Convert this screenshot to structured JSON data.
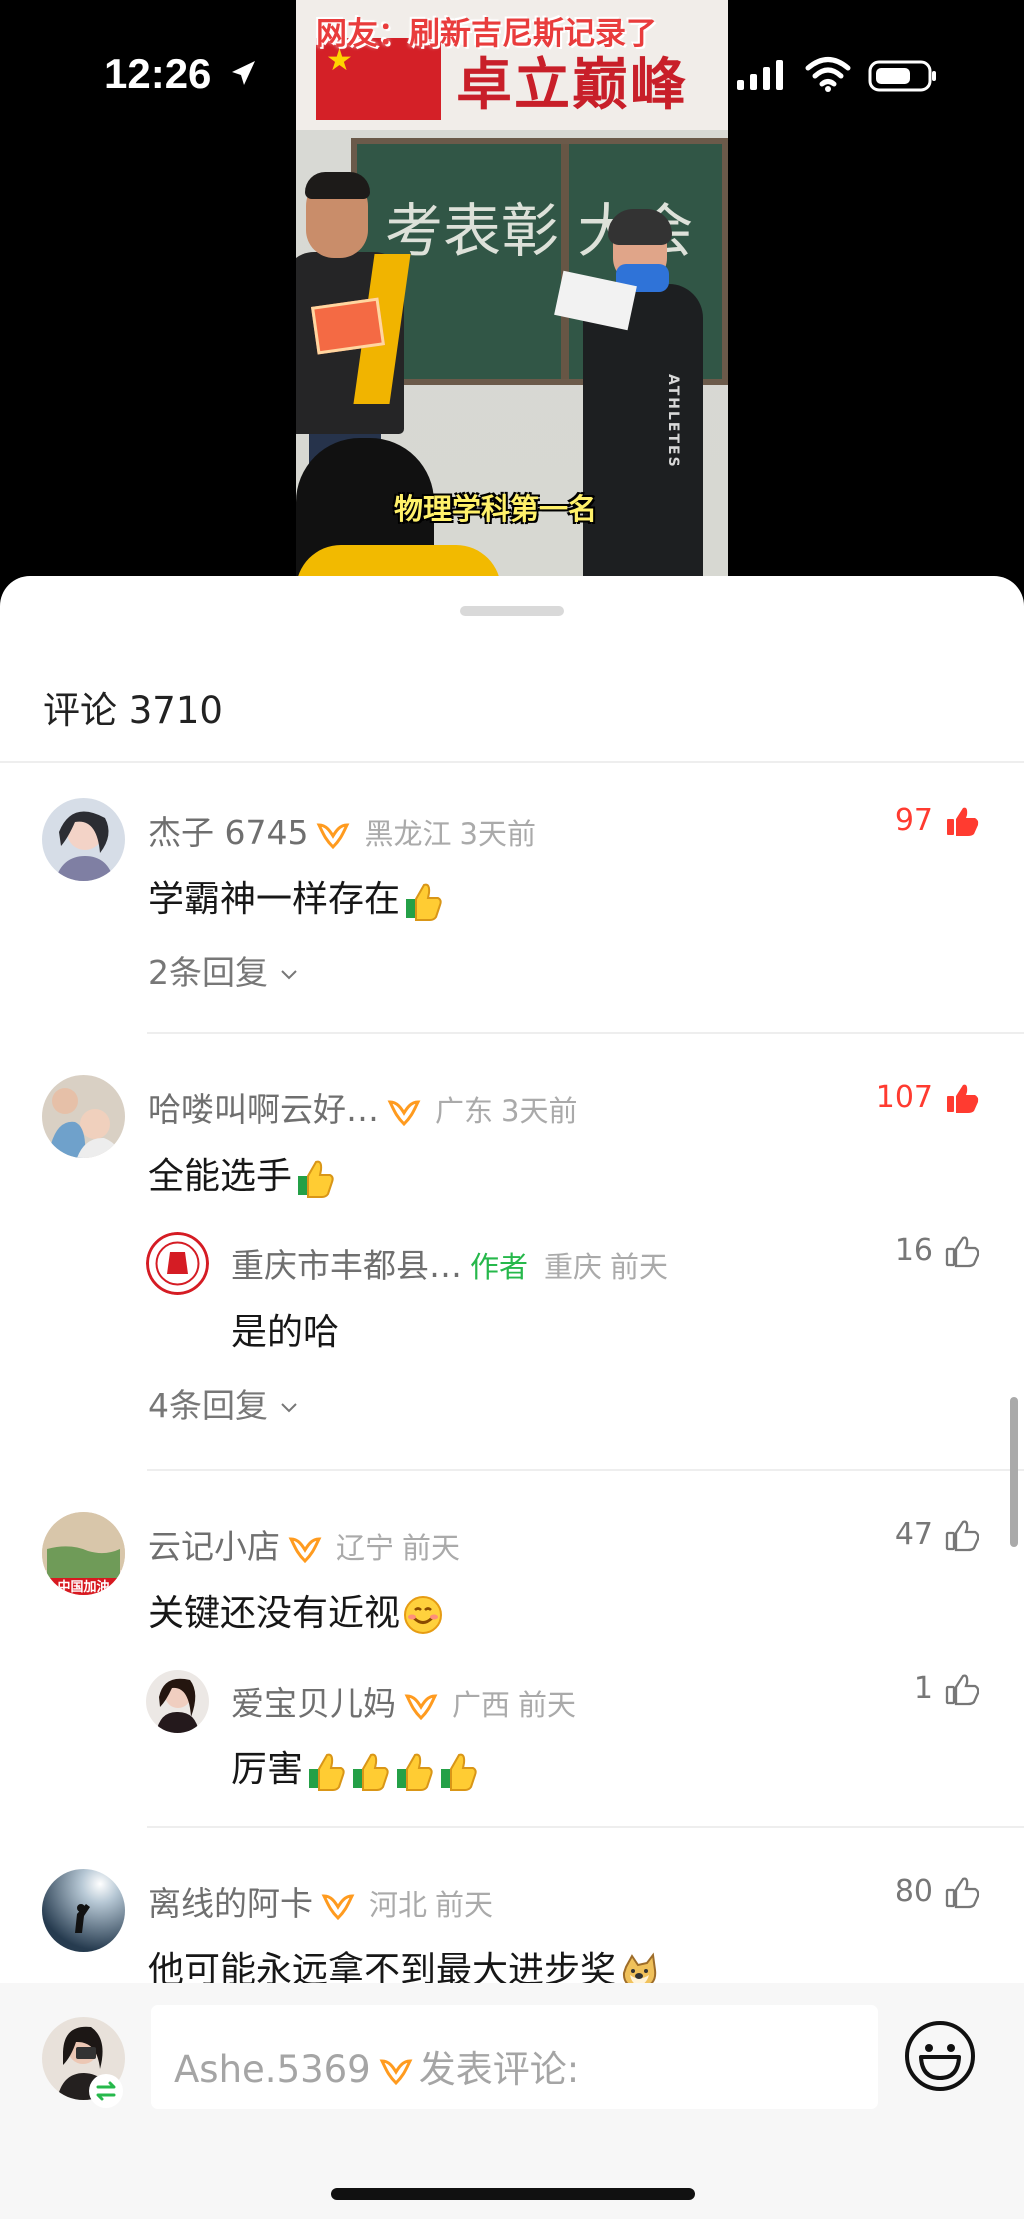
{
  "status": {
    "time": "12:26",
    "icons": [
      "location-arrow-icon",
      "cell-signal-icon",
      "wifi-icon",
      "battery-icon"
    ]
  },
  "video": {
    "overlay_title": "网友：刷新吉尼斯记录了",
    "banner": "卓立巅峰",
    "chalkboard": "考表彰 大会",
    "caption": "物理学科第一名",
    "coat_text": "ATHLETES"
  },
  "comments_header": {
    "label": "评论",
    "count": "3710"
  },
  "comments": [
    {
      "username": "杰子 6745",
      "location": "黑龙江",
      "time": "3天前",
      "text": "学霸神一样存在",
      "emoji": "thumbs-up-emoji",
      "likes": "97",
      "liked": true,
      "replies_label": "2条回复"
    },
    {
      "username": "哈喽叫啊云好…",
      "location": "广东",
      "time": "3天前",
      "text": "全能选手",
      "emoji": "thumbs-up-emoji",
      "likes": "107",
      "liked": true,
      "reply": {
        "username": "重庆市丰都县…",
        "author_tag": "作者",
        "location": "重庆",
        "time": "前天",
        "text": "是的哈",
        "likes": "16"
      },
      "replies_label": "4条回复"
    },
    {
      "username": "云记小店",
      "location": "辽宁",
      "time": "前天",
      "text": "关键还没有近视",
      "emoji": "smile-emoji",
      "likes": "47",
      "liked": false,
      "avatar_text": "中国加油",
      "reply": {
        "username": "爱宝贝儿妈",
        "location": "广西",
        "time": "前天",
        "text": "厉害",
        "likes": "1"
      }
    },
    {
      "username": "离线的阿卡",
      "location": "河北",
      "time": "前天",
      "text": "他可能永远拿不到最大进步奖",
      "emoji": "doge-emoji",
      "likes": "80",
      "liked": false
    }
  ],
  "composer": {
    "user": "Ashe.5369",
    "placeholder": "发表评论:"
  },
  "colors": {
    "accent_red": "#ff3b30",
    "author_green": "#26b84b",
    "badge_orange": "#ff9b1f"
  }
}
